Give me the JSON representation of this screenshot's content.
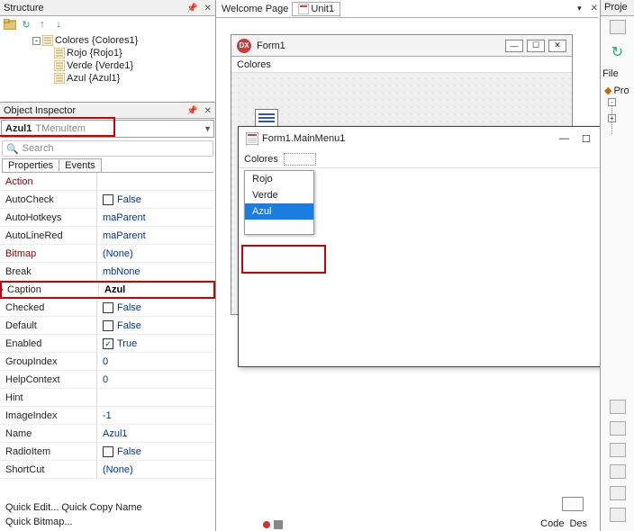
{
  "structure": {
    "title": "Structure",
    "items": [
      {
        "label": "Colores {Colores1}"
      },
      {
        "label": "Rojo {Rojo1}"
      },
      {
        "label": "Verde {Verde1}"
      },
      {
        "label": "Azul {Azul1}"
      }
    ]
  },
  "inspector": {
    "title": "Object Inspector",
    "combo_name": "Azul1",
    "combo_type": "TMenuItem",
    "search_placeholder": "Search",
    "tabs": {
      "properties": "Properties",
      "events": "Events"
    },
    "props": [
      {
        "name": "Action",
        "value": "",
        "kind": "link"
      },
      {
        "name": "AutoCheck",
        "value": "False",
        "kind": "checkbox",
        "checked": false
      },
      {
        "name": "AutoHotkeys",
        "value": "maParent",
        "kind": "text"
      },
      {
        "name": "AutoLineRed",
        "value": "maParent",
        "kind": "text"
      },
      {
        "name": "Bitmap",
        "value": "(None)",
        "kind": "text"
      },
      {
        "name": "Break",
        "value": "mbNone",
        "kind": "text"
      },
      {
        "name": "Caption",
        "value": "Azul",
        "kind": "bold"
      },
      {
        "name": "Checked",
        "value": "False",
        "kind": "checkbox",
        "checked": false
      },
      {
        "name": "Default",
        "value": "False",
        "kind": "checkbox",
        "checked": false
      },
      {
        "name": "Enabled",
        "value": "True",
        "kind": "checkbox",
        "checked": true
      },
      {
        "name": "GroupIndex",
        "value": "0",
        "kind": "text"
      },
      {
        "name": "HelpContext",
        "value": "0",
        "kind": "text"
      },
      {
        "name": "Hint",
        "value": "",
        "kind": "text"
      },
      {
        "name": "ImageIndex",
        "value": "-1",
        "kind": "text"
      },
      {
        "name": "Name",
        "value": "Azul1",
        "kind": "text"
      },
      {
        "name": "RadioItem",
        "value": "False",
        "kind": "checkbox",
        "checked": false
      },
      {
        "name": "ShortCut",
        "value": "(None)",
        "kind": "text"
      }
    ],
    "quick_links": "Quick Edit...   Quick Copy Name",
    "quick_bitmap": "Quick Bitmap..."
  },
  "center": {
    "welcome_tab": "Welcome Page",
    "unit_tab": "Unit1",
    "form_title": "Form1",
    "form_menu_item": "Colores",
    "component_label": "MainMenu1"
  },
  "menu_editor": {
    "title": "Form1.MainMenu1",
    "menu_label": "Colores",
    "items": [
      "Rojo",
      "Verde",
      "Azul"
    ],
    "selected": "Azul"
  },
  "right": {
    "title": "Proje",
    "file_label": "File",
    "pro_label": "Pro"
  },
  "status": {
    "code": "Code",
    "des": "Des"
  }
}
